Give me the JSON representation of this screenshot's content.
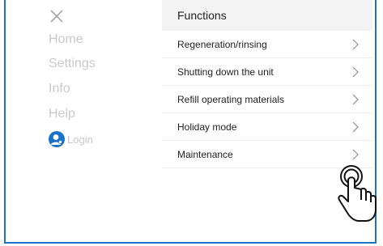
{
  "sidebar": {
    "items": [
      {
        "label": "Home"
      },
      {
        "label": "Settings"
      },
      {
        "label": "Info"
      },
      {
        "label": "Help"
      }
    ],
    "login_label": "Login"
  },
  "functions": {
    "title": "Functions",
    "rows": [
      {
        "label": "Regeneration/rinsing"
      },
      {
        "label": "Shutting down the unit"
      },
      {
        "label": "Refill operating materials"
      },
      {
        "label": "Holiday mode"
      },
      {
        "label": "Maintenance"
      }
    ]
  },
  "colors": {
    "accent": "#1a73c9",
    "muted_text": "#c9c9c9",
    "header_bg": "#f3f3f3"
  },
  "icons": [
    "close-icon",
    "user-icon",
    "chevron-right-icon",
    "tap-hand-icon"
  ]
}
